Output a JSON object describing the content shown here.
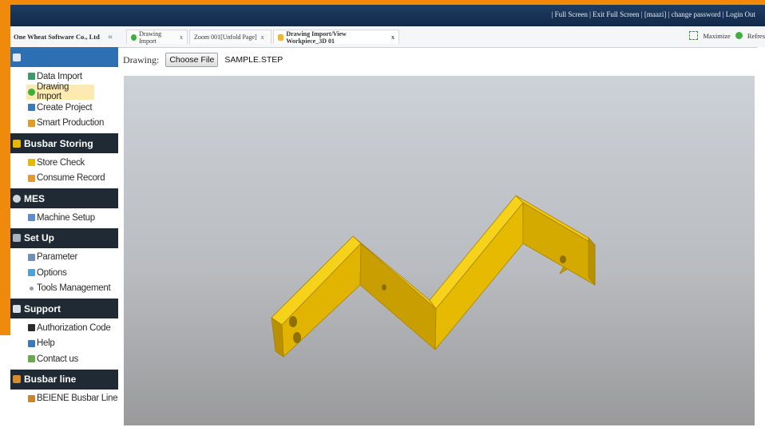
{
  "header": {
    "links_text": "| Full Screen | Exit Full Screen | [maazi] | change password | Login Out"
  },
  "company": "One Wheat Software Co., Ltd",
  "collapse_icon": "«",
  "tabs": [
    {
      "label": "Drawing Import",
      "close": "x",
      "icon": "drawing-import-icon",
      "active": false
    },
    {
      "label": "Zoom 001[Unfold Page]",
      "close": "x",
      "icon": "",
      "active": false
    },
    {
      "label": "Drawing Import/View Workpiece_3D 01",
      "close": "x",
      "icon": "workpiece-icon",
      "active": true
    }
  ],
  "tools": {
    "maximize": "Maximize",
    "refresh": "Refres"
  },
  "sidebar": {
    "sections": [
      {
        "title": "",
        "items": [
          "Data Import",
          "Drawing Import",
          "Create Project",
          "Smart Production"
        ]
      },
      {
        "title": "Busbar Storing",
        "items": [
          "Store Check",
          "Consume Record"
        ]
      },
      {
        "title": "MES",
        "items": [
          "Machine Setup"
        ]
      },
      {
        "title": "Set Up",
        "items": [
          "Parameter",
          "Options",
          "Tools Management"
        ]
      },
      {
        "title": "Support",
        "items": [
          "Authorization Code",
          "Help",
          "Contact us"
        ]
      },
      {
        "title": "Busbar line",
        "items": [
          "BEIENE Busbar Line"
        ]
      }
    ],
    "selected": "Drawing Import"
  },
  "content": {
    "drawing_label": "Drawing:",
    "choose_button": "Choose File",
    "file_name": "SAMPLE.STEP"
  },
  "colors": {
    "accent_orange": "#ef8a0c",
    "topbar": "#1e3d63",
    "busbar": "#e6b800"
  }
}
